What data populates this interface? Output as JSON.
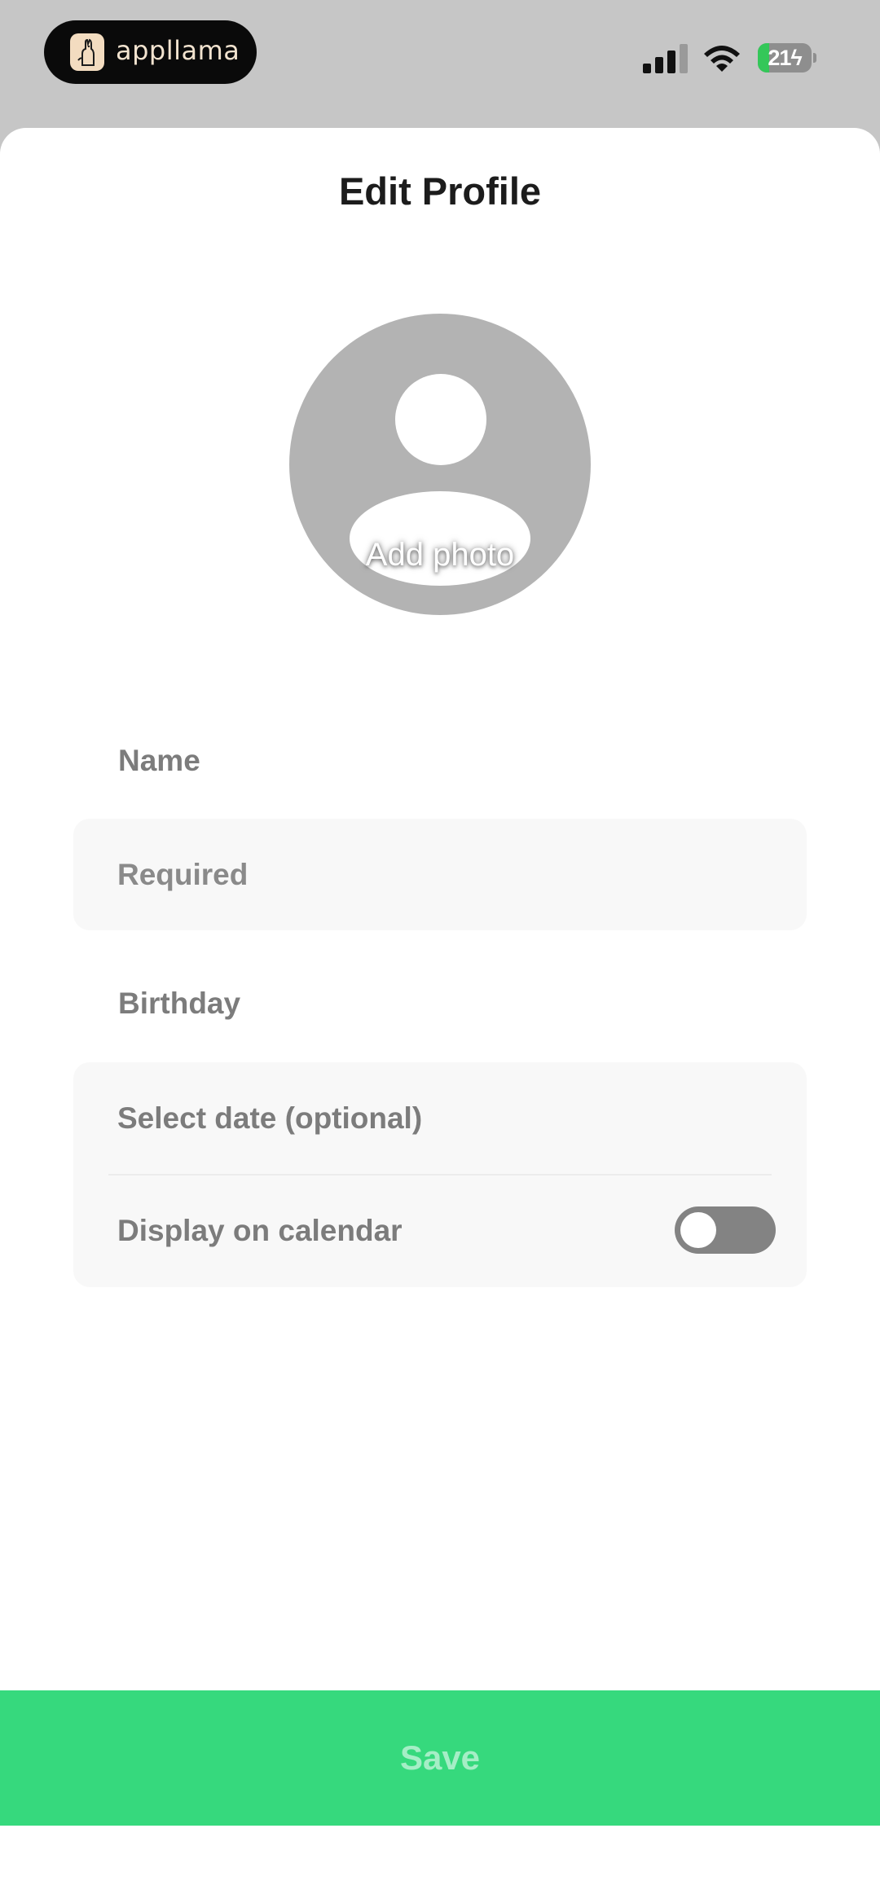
{
  "status_bar": {
    "app_name": "appllama",
    "battery_level": "21",
    "battery_fraction": 0.21,
    "signal_bars_filled": 3,
    "signal_bars_total": 4,
    "icons": {
      "app_logo": "llama-logo-icon",
      "signal": "cellular-signal-icon",
      "wifi": "wifi-icon",
      "battery": "battery-charging-icon"
    }
  },
  "header": {
    "title": "Edit Profile"
  },
  "avatar": {
    "icon": "person-placeholder-icon",
    "caption": "Add photo"
  },
  "form": {
    "name_label": "Name",
    "name_value": "",
    "name_placeholder": "Required",
    "birthday_label": "Birthday",
    "date_placeholder": "Select date (optional)",
    "calendar_label": "Display on calendar",
    "calendar_toggle_on": false
  },
  "actions": {
    "save_label": "Save"
  },
  "colors": {
    "accent_green": "#36d97d",
    "save_text": "#a5eec6",
    "label_gray": "#7c7c7c",
    "field_bg": "#f8f8f8",
    "toggle_off": "#838383",
    "battery_fill": "#34c759"
  }
}
